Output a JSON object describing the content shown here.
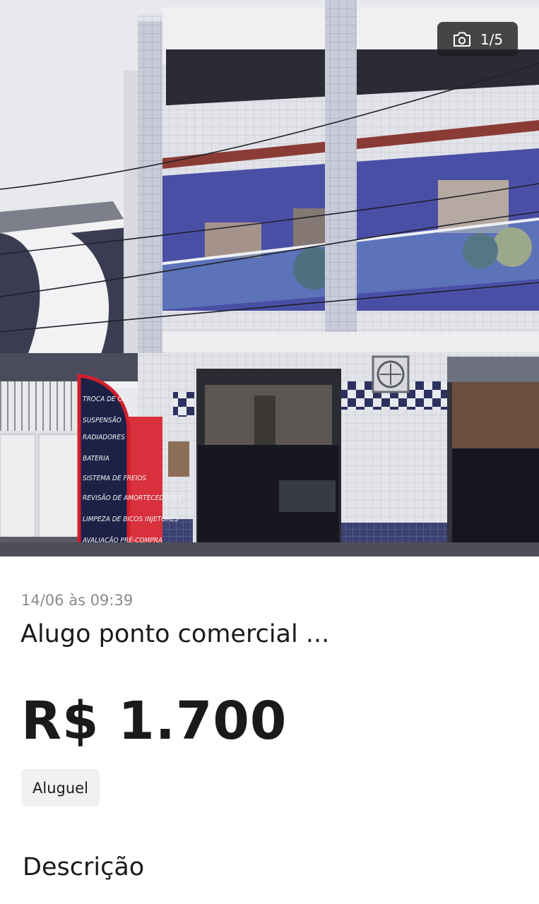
{
  "gallery": {
    "counter_text": "1/5",
    "counter_icon": "camera-icon",
    "sign_lines": [
      "TROCA DE ÓLEO",
      "SUSPENSÃO",
      "RADIADORES",
      "BATERIA",
      "SISTEMA DE FREIOS",
      "REVISÃO DE AMORTECEDORES",
      "LIMPEZA DE BICOS INJETORES",
      "AVALIAÇÃO PRÉ-COMPRA"
    ],
    "colors": {
      "sky": "#e9eaee",
      "tile": "#dcdde3",
      "balcony_wall": "#4a4fa6",
      "dark_floor": "#1c1c28",
      "sign": "#1d2146",
      "sign_border": "#d21f2e",
      "red_door": "#d8303c"
    }
  },
  "listing": {
    "date": "14/06 às 09:39",
    "title": "Alugo ponto comercial ...",
    "price": "R$ 1.700",
    "tag": "Aluguel",
    "description_heading": "Descrição"
  }
}
